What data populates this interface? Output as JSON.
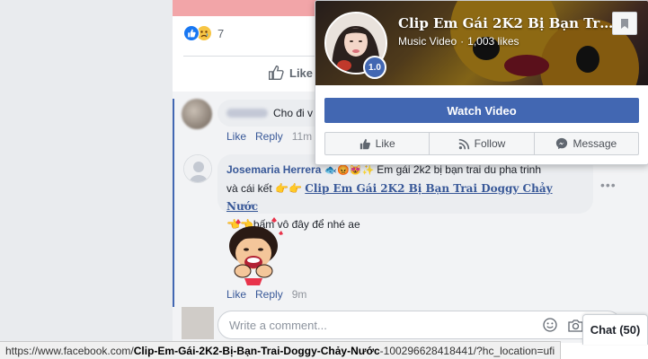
{
  "post": {
    "reaction_count": "7",
    "like_action": "Like"
  },
  "comment1": {
    "text": "Cho đi v",
    "like": "Like",
    "reply": "Reply",
    "time": "11m"
  },
  "comment2": {
    "author": "Josemaria Herrera",
    "text_a": "Em gái 2k2 bị bạn trai du pha trinh",
    "text_b": "và cái kết",
    "link": "Clip Em Gái 2K2 Bị Bạn Trai Doggy Chảy Nước",
    "text_c": "bấm vô đây để nhé ae",
    "like": "Like",
    "reply": "Reply",
    "time": "9m"
  },
  "composer": {
    "placeholder": "Write a comment..."
  },
  "hovercard": {
    "page_name": "Clip Em Gái 2K2 Bị Bạn Trai...",
    "category": "Music Video",
    "separator": "·",
    "likes": "1,003 likes",
    "badge": "1.0",
    "watch_button": "Watch Video",
    "like_button": "Like",
    "follow_button": "Follow",
    "message_button": "Message"
  },
  "chat": {
    "label": "Chat (50)"
  },
  "status": {
    "url_prefix": "https://www.facebook.com/",
    "url_bold": "Clip-Em-Gái-2K2-Bị-Bạn-Trai-Doggy-Chảy-Nước",
    "url_suffix": "-100296628418441/?hc_location=ufi"
  },
  "colors": {
    "brand": "#4267b2",
    "link": "#385898"
  }
}
